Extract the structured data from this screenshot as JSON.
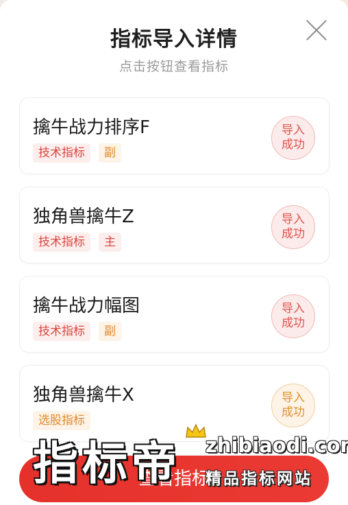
{
  "header": {
    "title": "指标导入详情",
    "subtitle": "点击按钮查看指标"
  },
  "cards": [
    {
      "name": "擒牛战力排序F",
      "tags": [
        {
          "text": "技术指标",
          "color": "red"
        },
        {
          "text": "副",
          "color": "orange"
        }
      ],
      "status": [
        "导入",
        "成功"
      ],
      "status_color": "red"
    },
    {
      "name": "独角兽擒牛Z",
      "tags": [
        {
          "text": "技术指标",
          "color": "red"
        },
        {
          "text": "主",
          "color": "red"
        }
      ],
      "status": [
        "导入",
        "成功"
      ],
      "status_color": "red"
    },
    {
      "name": "擒牛战力幅图",
      "tags": [
        {
          "text": "技术指标",
          "color": "red"
        },
        {
          "text": "副",
          "color": "orange"
        }
      ],
      "status": [
        "导入",
        "成功"
      ],
      "status_color": "red"
    },
    {
      "name": "独角兽擒牛X",
      "tags": [
        {
          "text": "选股指标",
          "color": "orange"
        }
      ],
      "status": [
        "导入",
        "成功"
      ],
      "status_color": "orange"
    }
  ],
  "bottom_button": {
    "label": "查看指标"
  },
  "watermark": {
    "brand": "指标帝",
    "url": "zhibiaodi.com",
    "tagline": "精品指标网站"
  },
  "icons": {
    "close": "close-icon",
    "crown": "crown-icon"
  },
  "colors": {
    "accent": "#e6312b",
    "tag_red": "#d8473e",
    "tag_orange": "#e08a2e"
  }
}
